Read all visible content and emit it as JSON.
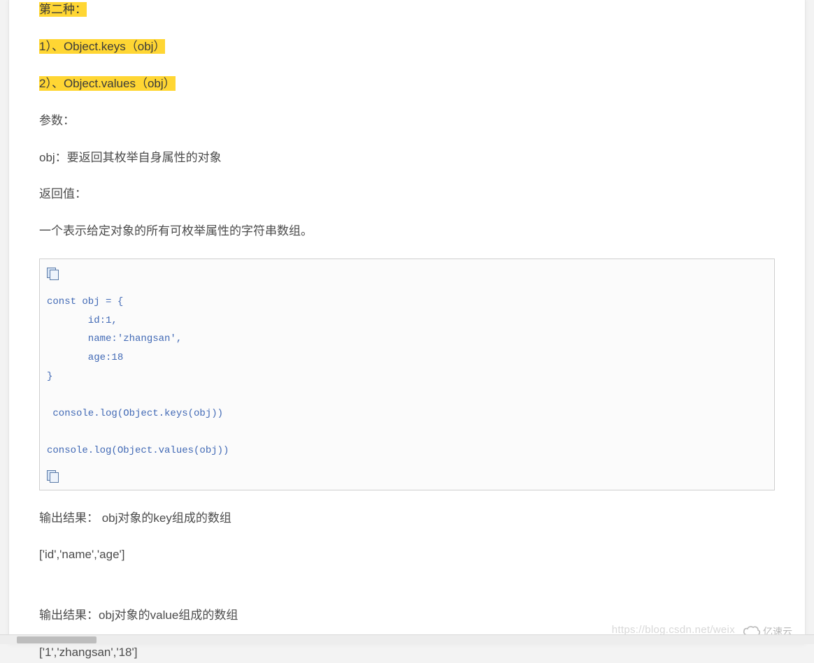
{
  "content": {
    "heading_second": "第二种：",
    "item1": "1）、Object.keys（obj） ",
    "item2": "2）、Object.values（obj） ",
    "params_label": "参数：",
    "params_desc": "obj：要返回其枚举自身属性的对象",
    "return_label": "返回值：",
    "return_desc": "一个表示给定对象的所有可枚举属性的字符串数组。",
    "output1_label": "输出结果：  obj对象的key组成的数组",
    "output1_value": "['id','name','age']",
    "output2_label": "输出结果：obj对象的value组成的数组",
    "output2_value": "['1','zhangsan','18']"
  },
  "code": {
    "snippet": "const obj = {\n       id:1,\n       name:'zhangsan',\n       age:18\n}\n\n console.log(Object.keys(obj))\n\nconsole.log(Object.values(obj))"
  },
  "watermark": {
    "url": "https://blog.csdn.net/weix",
    "brand": "亿速云"
  }
}
